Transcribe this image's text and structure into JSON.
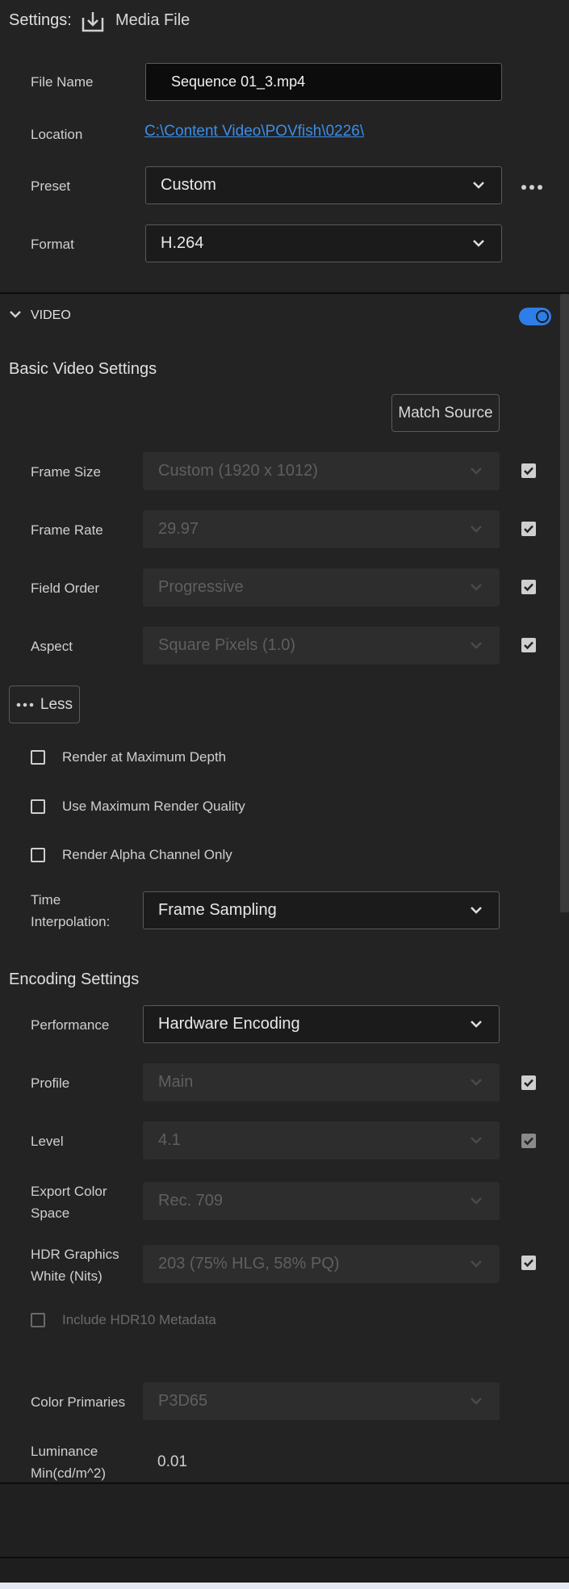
{
  "header": {
    "settings_label": "Settings:",
    "media_label": "Media File",
    "file_name_label": "File Name",
    "file_name_value": "Sequence 01_3.mp4",
    "location_label": "Location",
    "location_value": "C:\\Content Video\\POVfish\\0226\\",
    "preset_label": "Preset",
    "preset_value": "Custom",
    "format_label": "Format",
    "format_value": "H.264"
  },
  "video": {
    "section_label": "VIDEO",
    "enabled": true,
    "basic_title": "Basic Video Settings",
    "match_source": "Match Source",
    "frame_size_label": "Frame Size",
    "frame_size_value": "Custom (1920 x 1012)",
    "frame_rate_label": "Frame Rate",
    "frame_rate_value": "29.97",
    "field_order_label": "Field Order",
    "field_order_value": "Progressive",
    "aspect_label": "Aspect",
    "aspect_value": "Square Pixels (1.0)",
    "less_label": "Less",
    "render_max_depth": "Render at Maximum Depth",
    "max_render_quality": "Use Maximum Render Quality",
    "render_alpha": "Render Alpha Channel Only",
    "time_interp_label_1": "Time",
    "time_interp_label_2": "Interpolation:",
    "time_interp_value": "Frame Sampling"
  },
  "encoding": {
    "title": "Encoding Settings",
    "performance_label": "Performance",
    "performance_value": "Hardware Encoding",
    "profile_label": "Profile",
    "profile_value": "Main",
    "level_label": "Level",
    "level_value": "4.1",
    "color_space_label_1": "Export Color",
    "color_space_label_2": "Space",
    "color_space_value": "Rec. 709",
    "hdr_label_1": "HDR Graphics",
    "hdr_label_2": "White (Nits)",
    "hdr_value": "203 (75% HLG, 58% PQ)",
    "hdr10_label": "Include HDR10 Metadata",
    "color_primaries_label": "Color Primaries",
    "color_primaries_value": "P3D65",
    "luminance_label_1": "Luminance",
    "luminance_label_2": "Min(cd/m^2)",
    "luminance_value": "0.01"
  },
  "colors": {
    "accent": "#2d7ee8",
    "link": "#3b8eea"
  }
}
